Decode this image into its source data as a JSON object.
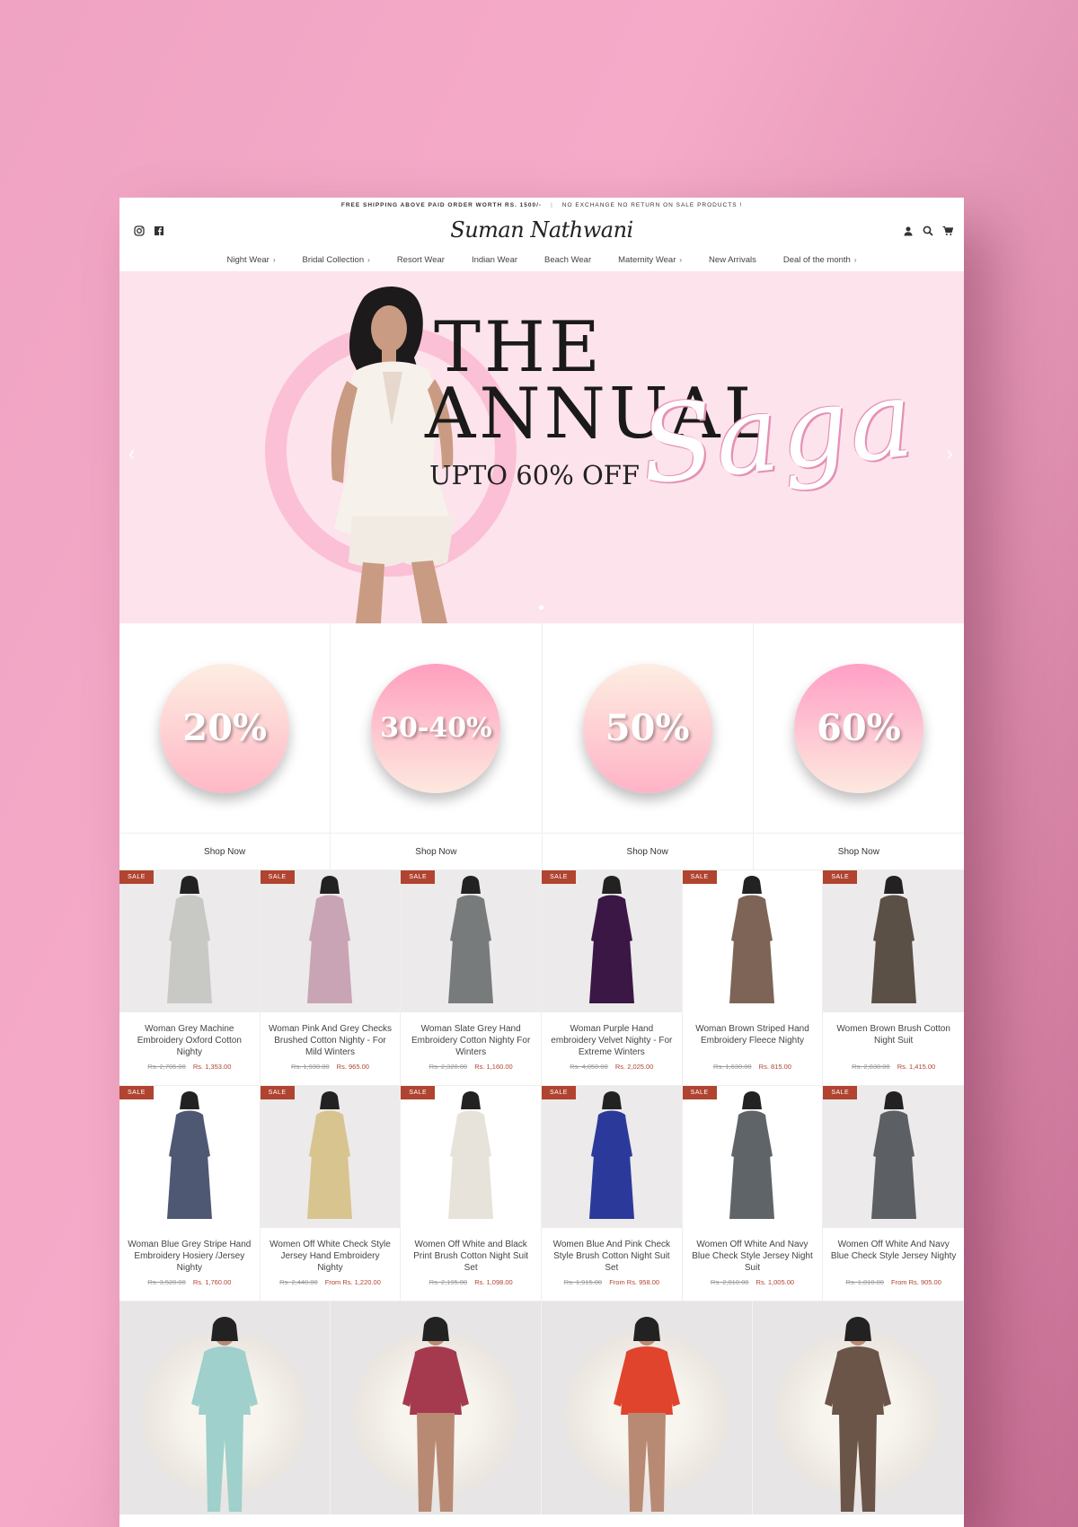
{
  "announcement": {
    "left": "FREE SHIPPING ABOVE PAID ORDER WORTH RS. 1500/-",
    "separator": "|",
    "right": "NO EXCHANGE NO RETURN ON SALE PRODUCTS !"
  },
  "header": {
    "logo": "Suman Nathwani",
    "social_icons": [
      "instagram-icon",
      "facebook-icon"
    ],
    "tool_icons": [
      "account-icon",
      "search-icon",
      "cart-icon"
    ]
  },
  "nav": [
    {
      "label": "Night Wear",
      "has_dropdown": true
    },
    {
      "label": "Bridal Collection",
      "has_dropdown": true
    },
    {
      "label": "Resort Wear",
      "has_dropdown": false
    },
    {
      "label": "Indian Wear",
      "has_dropdown": false
    },
    {
      "label": "Beach Wear",
      "has_dropdown": false
    },
    {
      "label": "Maternity Wear",
      "has_dropdown": true
    },
    {
      "label": "New Arrivals",
      "has_dropdown": false
    },
    {
      "label": "Deal of the month",
      "has_dropdown": true
    }
  ],
  "hero": {
    "line1": "THE",
    "line2": "ANNUAL",
    "script": "Saga",
    "subtitle": "UPTO 60% OFF",
    "bg_color": "#fde3ec"
  },
  "offers": [
    {
      "label": "20%",
      "cta": "Shop Now"
    },
    {
      "label": "30-40%",
      "cta": "Shop Now"
    },
    {
      "label": "50%",
      "cta": "Shop Now"
    },
    {
      "label": "60%",
      "cta": "Shop Now"
    }
  ],
  "products": [
    {
      "badge": "SALE",
      "name": "Woman Grey Machine Embroidery Oxford Cotton Nighty",
      "old_price": "Rs. 2,705.00",
      "price": "Rs. 1,353.00",
      "color": "#c8c9c4"
    },
    {
      "badge": "SALE",
      "name": "Woman Pink And Grey Checks Brushed Cotton Nighty - For Mild Winters",
      "old_price": "Rs. 1,930.00",
      "price": "Rs. 965.00",
      "color": "#c9a4b4"
    },
    {
      "badge": "SALE",
      "name": "Woman Slate Grey Hand Embroidery Cotton Nighty For Winters",
      "old_price": "Rs. 2,320.00",
      "price": "Rs. 1,160.00",
      "color": "#777b7c"
    },
    {
      "badge": "SALE",
      "name": "Woman Purple Hand embroidery Velvet Nighty - For Extreme Winters",
      "old_price": "Rs. 4,050.00",
      "price": "Rs. 2,025.00",
      "color": "#3b1746"
    },
    {
      "badge": "SALE",
      "name": "Woman Brown Striped Hand Embroidery Fleece Nighty",
      "old_price": "Rs. 1,630.00",
      "price": "Rs. 815.00",
      "color": "#7d6457"
    },
    {
      "badge": "SALE",
      "name": "Women Brown Brush Cotton Night Suit",
      "old_price": "Rs. 2,830.00",
      "price": "Rs. 1,415.00",
      "color": "#5b5046"
    },
    {
      "badge": "SALE",
      "name": "Woman Blue Grey Stripe Hand Embroidery Hosiery /Jersey Nighty",
      "old_price": "Rs. 3,520.00",
      "price": "Rs. 1,760.00",
      "color": "#4f5873"
    },
    {
      "badge": "SALE",
      "name": "Women Off White Check Style Jersey Hand Embroidery Nighty",
      "old_price": "Rs. 2,440.00",
      "price": "From Rs. 1,220.00",
      "color": "#d8c48f"
    },
    {
      "badge": "SALE",
      "name": "Women Off White and Black Print Brush Cotton Night Suit Set",
      "old_price": "Rs. 2,195.00",
      "price": "Rs. 1,098.00",
      "color": "#e7e3da"
    },
    {
      "badge": "SALE",
      "name": "Women Blue And Pink Check Style Brush Cotton Night Suit Set",
      "old_price": "Rs. 1,915.00",
      "price": "From Rs. 958.00",
      "color": "#2b3a9a"
    },
    {
      "badge": "SALE",
      "name": "Women Off White And Navy Blue Check Style Jersey Night Suit",
      "old_price": "Rs. 2,010.00",
      "price": "Rs. 1,005.00",
      "color": "#5f6468"
    },
    {
      "badge": "SALE",
      "name": "Women Off White And Navy Blue Check Style Jersey Nighty",
      "old_price": "Rs. 1,810.00",
      "price": "From Rs. 905.00",
      "color": "#5c6064"
    }
  ],
  "bottom_tiles": [
    {
      "color": "#9fd0cb"
    },
    {
      "color": "#a53a4e"
    },
    {
      "color": "#e0442c"
    },
    {
      "color": "#6b5448"
    }
  ],
  "colors": {
    "accent": "#b04430",
    "page_bg": "#f0a3c3"
  }
}
